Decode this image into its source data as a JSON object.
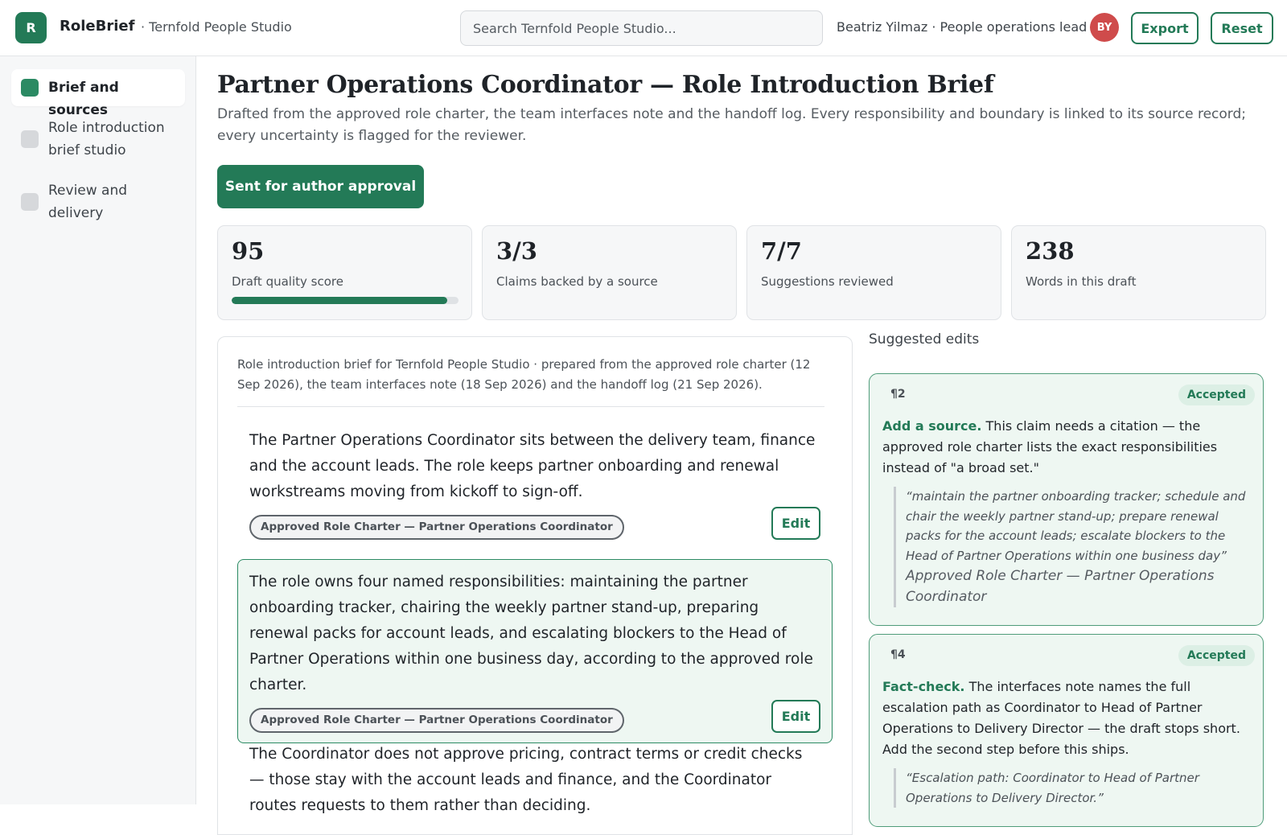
{
  "app": {
    "logo_letter": "R",
    "name": "RoleBrief",
    "workspace": "· Ternfold People Studio"
  },
  "search": {
    "placeholder": "Search Ternfold People Studio..."
  },
  "user": {
    "label": "Beatriz Yilmaz · People operations lead",
    "initials": "BY"
  },
  "actions": {
    "export": "Export",
    "reset": "Reset"
  },
  "sidebar": {
    "items": [
      {
        "label": "Brief and sources",
        "active": true
      },
      {
        "label": "Role introduction brief studio",
        "active": false
      },
      {
        "label": "Review and delivery",
        "active": false
      }
    ]
  },
  "page": {
    "title": "Partner Operations Coordinator — Role Introduction Brief",
    "subtitle": "Drafted from the approved role charter, the team interfaces note and the handoff log. Every responsibility and boundary is linked to its source record; every uncertainty is flagged for the reviewer.",
    "status_button": "Sent for author approval"
  },
  "stats": [
    {
      "value": "95",
      "label": "Draft quality score",
      "progress_percent": 95
    },
    {
      "value": "3/3",
      "label": "Claims backed by a source"
    },
    {
      "value": "7/7",
      "label": "Suggestions reviewed"
    },
    {
      "value": "238",
      "label": "Words in this draft"
    }
  ],
  "doc": {
    "meta": "Role introduction brief for Ternfold People Studio · prepared from the approved role charter (12 Sep 2026), the team interfaces note (18 Sep 2026) and the handoff log (21 Sep 2026).",
    "edit_label": "Edit",
    "paragraphs": [
      {
        "text": "The Partner Operations Coordinator sits between the delivery team, finance and the account leads. The role keeps partner onboarding and renewal workstreams moving from kickoff to sign-off.",
        "source": "Approved Role Charter — Partner Operations Coordinator"
      },
      {
        "text": "The role owns four named responsibilities: maintaining the partner onboarding tracker, chairing the weekly partner stand-up, preparing renewal packs for account leads, and escalating blockers to the Head of Partner Operations within one business day, according to the approved role charter.",
        "source": "Approved Role Charter — Partner Operations Coordinator"
      },
      {
        "text": "The Coordinator does not approve pricing, contract terms or credit checks — those stay with the account leads and finance, and the Coordinator routes requests to them rather than deciding."
      }
    ]
  },
  "suggestions": {
    "title": "Suggested edits",
    "items": [
      {
        "para": "¶2",
        "status": "Accepted",
        "kind": "Add a source.",
        "text": "This claim needs a citation — the approved role charter lists the exact responsibilities instead of \"a broad set.\"",
        "quote": "“maintain the partner onboarding tracker; schedule and chair the weekly partner stand-up; prepare renewal packs for the account leads; escalate blockers to the Head of Partner Operations within one business day”",
        "source": "Approved Role Charter — Partner Operations Coordinator"
      },
      {
        "para": "¶4",
        "status": "Accepted",
        "kind": "Fact-check.",
        "text": "The interfaces note names the full escalation path as Coordinator to Head of Partner Operations to Delivery Director — the draft stops short. Add the second step before this ships.",
        "quote": "“Escalation path: Coordinator to Head of Partner Operations to Delivery Director.”"
      }
    ]
  },
  "colors": {
    "accent": "#237a57",
    "accent_light": "#eef7f2",
    "avatar": "#cf4b4b"
  }
}
